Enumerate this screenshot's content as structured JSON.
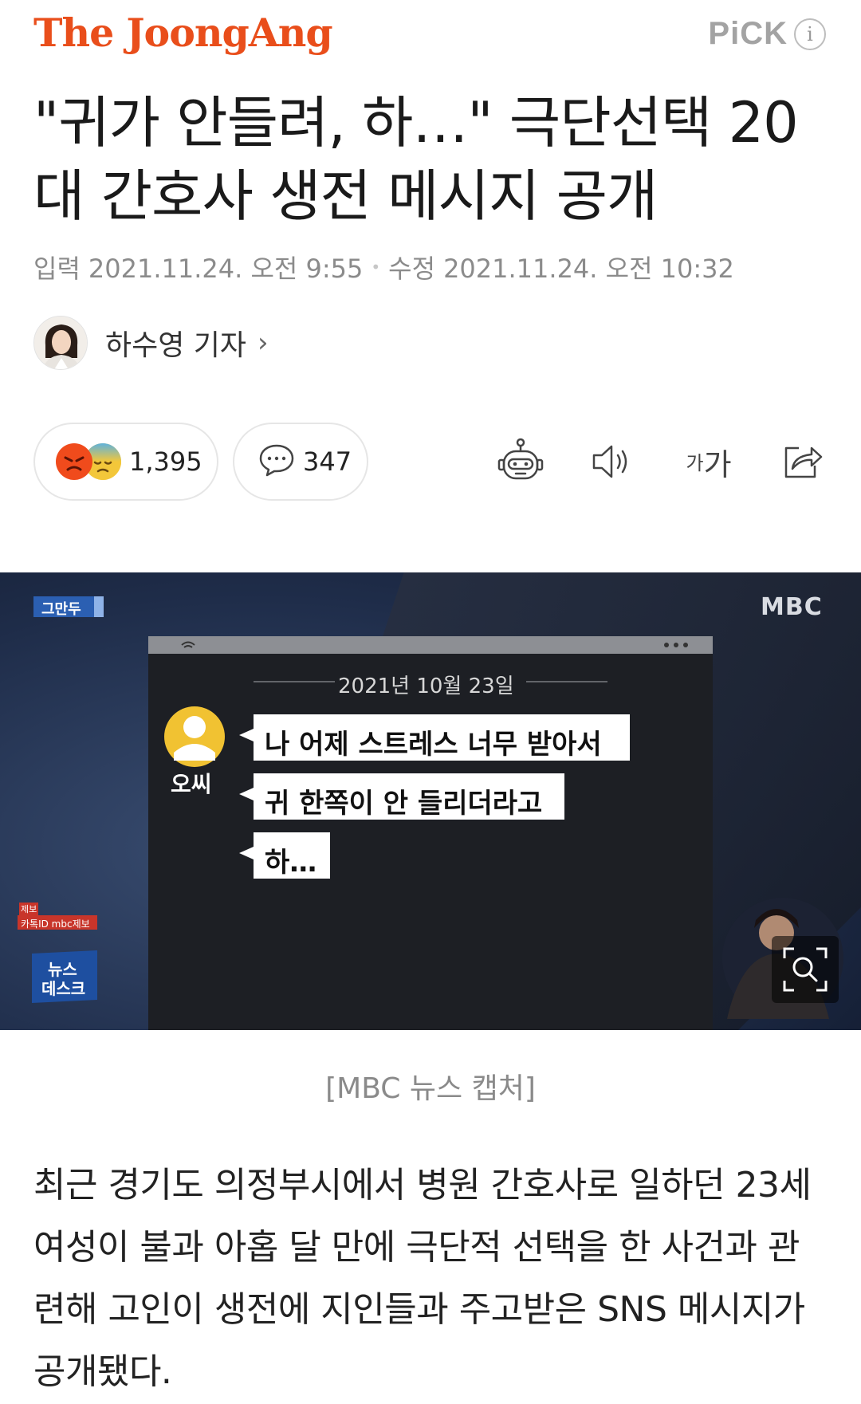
{
  "header": {
    "logo": "The JoongAng",
    "pick_label": "PiCK",
    "info_label": "i"
  },
  "article": {
    "title": "\"귀가 안들려, 하…\" 극단선택 20대 간호사 생전 메시지 공개",
    "input_label": "입력",
    "input_date": "2021.11.24. 오전 9:55",
    "modified_label": "수정",
    "modified_date": "2021.11.24. 오전 10:32",
    "author": "하수영 기자",
    "reactions_count": "1,395",
    "comments_count": "347",
    "caption": "[MBC 뉴스 캡처]",
    "body": "최근 경기도 의정부시에서 병원 간호사로 일하던 23세 여성이 불과 아홉 달 만에 극단적 선택을 한 사건과 관련해 고인이 생전에 지인들과 주고받은 SNS 메시지가 공개됐다."
  },
  "toolbar": {
    "font_size_label_small": "가",
    "font_size_label_large": "가"
  },
  "image": {
    "corner_badge": "그만두",
    "broadcaster": "MBC",
    "chat_date": "2021년 10월 23일",
    "sender": "오씨",
    "messages": [
      "나 어제 스트레스 너무 받아서",
      "귀 한쪽이 안 들리더라고",
      "하…"
    ],
    "report_tag": "제보",
    "report_line": "카톡ID mbc제보",
    "show_logo_line1": "뉴스",
    "show_logo_line2": "데스크"
  },
  "colors": {
    "brand": "#e94e1b",
    "muted": "#8b8b8b"
  }
}
